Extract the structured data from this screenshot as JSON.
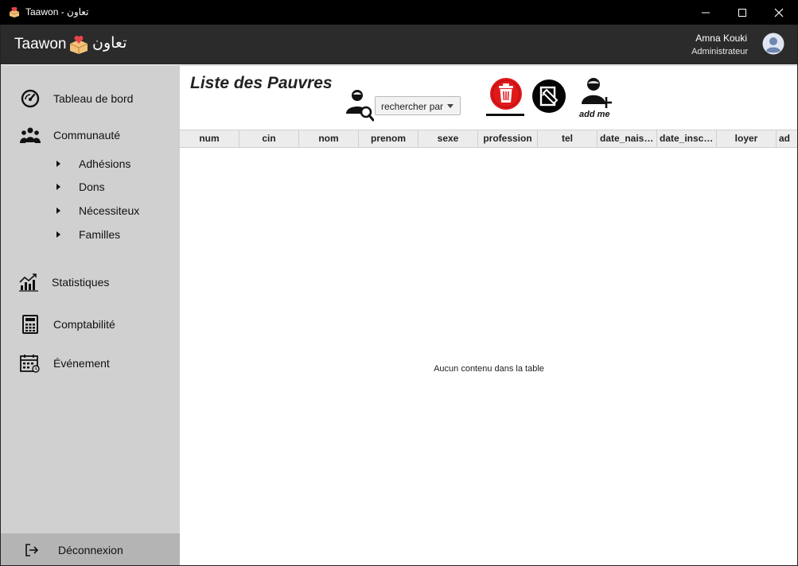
{
  "window": {
    "title": "Taawon - تعاون",
    "app_icon": "taawon-logo-icon",
    "controls": [
      "minimize-icon",
      "maximize-icon",
      "close-icon"
    ]
  },
  "header": {
    "brand_latin": "Taawon",
    "brand_arabic": "تعاون",
    "user_name": "Amna Kouki",
    "user_role": "Administrateur",
    "avatar_icon": "user-avatar-icon"
  },
  "sidebar": {
    "items": [
      {
        "label": "Tableau de bord",
        "icon": "dashboard-gauge-icon"
      },
      {
        "label": "Communauté",
        "icon": "community-users-icon"
      },
      {
        "label": "Statistiques",
        "icon": "statistics-chart-icon"
      },
      {
        "label": "Comptabilité",
        "icon": "calculator-icon"
      },
      {
        "label": "Événement",
        "icon": "calendar-icon"
      }
    ],
    "subitems": [
      {
        "label": "Adhésions"
      },
      {
        "label": "Dons"
      },
      {
        "label": "Nécessiteux"
      },
      {
        "label": "Familles"
      }
    ],
    "logout_label": "Déconnexion",
    "logout_icon": "logout-icon"
  },
  "main": {
    "title": "Liste des Pauvres",
    "search_icon": "user-search-icon",
    "search_combo": "rechercher par",
    "delete_icon": "trash-icon",
    "edit_icon": "edit-user-icon",
    "add_icon": "add-user-icon",
    "add_label": "add me",
    "columns": [
      "num",
      "cin",
      "nom",
      "prenom",
      "sexe",
      "profession",
      "tel",
      "date_naiss…",
      "date_inscr…",
      "loyer",
      "ad"
    ],
    "empty_message": "Aucun contenu dans la table"
  },
  "colors": {
    "titlebar": "#000000",
    "header": "#2b2b2b",
    "sidebar": "#d0d0d0",
    "logout_bg": "#b4b4b4",
    "delete_red": "#e0191b"
  }
}
